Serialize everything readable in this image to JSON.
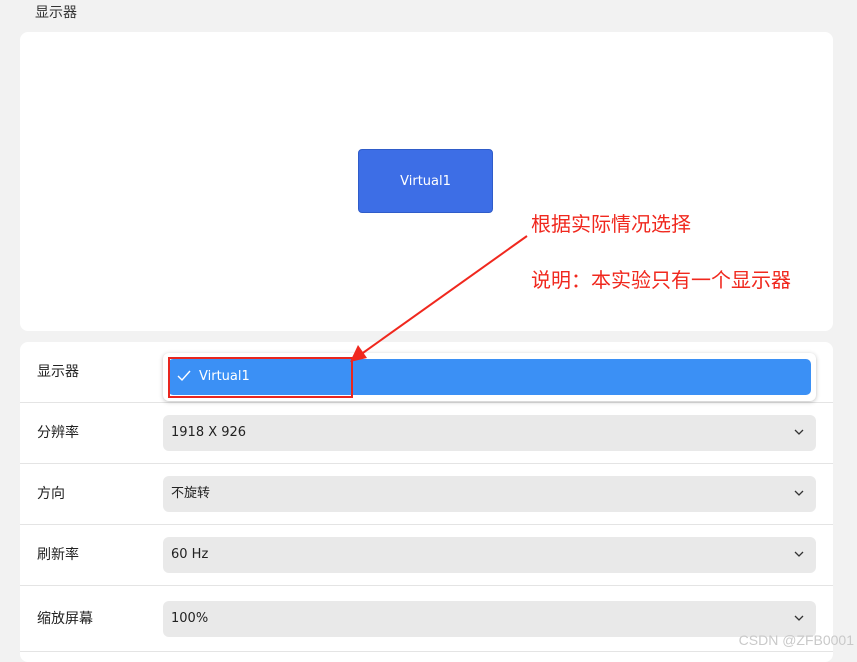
{
  "section_title": "显示器",
  "preview": {
    "monitor_label": "Virtual1"
  },
  "settings": {
    "display": {
      "label": "显示器",
      "selected": "Virtual1"
    },
    "resolution": {
      "label": "分辨率",
      "value": "1918 X 926"
    },
    "orientation": {
      "label": "方向",
      "value": "不旋转"
    },
    "refresh_rate": {
      "label": "刷新率",
      "value": "60 Hz"
    },
    "scale": {
      "label": "缩放屏幕",
      "value": "100%"
    }
  },
  "annotation": {
    "line1": "根据实际情况选择",
    "line2": "说明：本实验只有一个显示器",
    "color": "#f0281e"
  },
  "watermark": "CSDN @ZFB0001",
  "colors": {
    "monitor_tile": "#3d6ee6",
    "selected_item": "#3b90f5"
  }
}
